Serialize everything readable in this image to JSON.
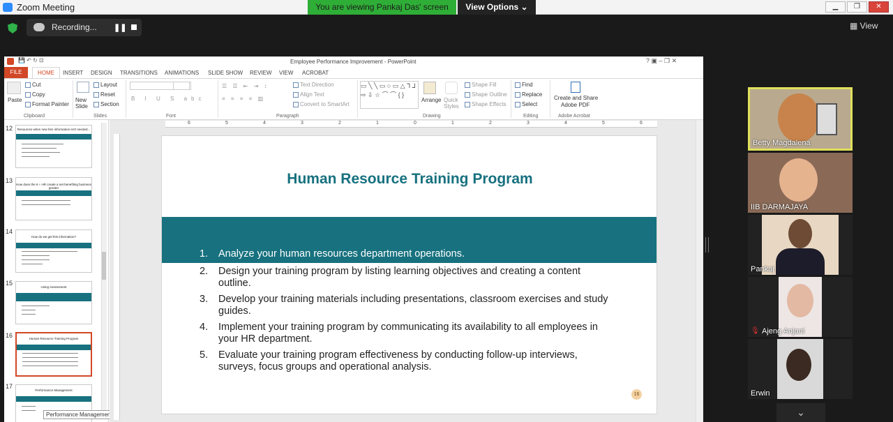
{
  "zoom": {
    "title": "Zoom Meeting",
    "banner": "You are viewing Pankaj Das' screen",
    "view_options": "View Options ⌄",
    "recording_label": "Recording...",
    "view_label": "View",
    "participants": [
      {
        "name": "Betty Magdalena"
      },
      {
        "name": "IIB DARMAJAYA"
      },
      {
        "name": "Pankaj"
      },
      {
        "name": "Ajeng Anjani"
      },
      {
        "name": "Erwin"
      }
    ]
  },
  "ppt": {
    "window_title": "Employee Performance Improvement - PowerPoint",
    "tabs": [
      "FILE",
      "HOME",
      "INSERT",
      "DESIGN",
      "TRANSITIONS",
      "ANIMATIONS",
      "SLIDE SHOW",
      "REVIEW",
      "VIEW",
      "ACROBAT"
    ],
    "ribbon": {
      "paste": "Paste",
      "cut": "Cut",
      "copy": "Copy",
      "format_painter": "Format Painter",
      "clipboard": "Clipboard",
      "new_slide": "New Slide",
      "layout": "Layout",
      "reset": "Reset",
      "section": "Section",
      "slides": "Slides",
      "font": "Font",
      "text_direction": "Text Direction",
      "align_text": "Align Text",
      "convert_smartart": "Convert to SmartArt",
      "paragraph": "Paragraph",
      "arrange": "Arrange",
      "quick_styles": "Quick Styles",
      "shape_fill": "Shape Fill",
      "shape_outline": "Shape Outline",
      "shape_effects": "Shape Effects",
      "drawing": "Drawing",
      "find": "Find",
      "replace": "Replace",
      "select": "Select",
      "editing": "Editing",
      "create_share": "Create and Share",
      "adobe_pdf": "Adobe PDF",
      "adobe_acrobat": "Adobe Acrobat"
    },
    "thumbnails": [
      {
        "num": "12",
        "title": "Resources when new hire information isn't needed..."
      },
      {
        "num": "13",
        "title": "How does the 6 + HR create a net benefiting business greater"
      },
      {
        "num": "14",
        "title": "How do we get this information?"
      },
      {
        "num": "15",
        "title": "Using Assessment"
      },
      {
        "num": "16",
        "title": "Human Resource Training Program"
      },
      {
        "num": "17",
        "title": "Performance Management"
      }
    ],
    "tooltip": "Performance Management",
    "ruler_marks": [
      "6",
      "5",
      "4",
      "3",
      "2",
      "1",
      "0",
      "1",
      "2",
      "3",
      "4",
      "5",
      "6"
    ],
    "slide": {
      "title": "Human Resource Training Program",
      "items": [
        {
          "n": "1.",
          "text": "Analyze your human resources department operations."
        },
        {
          "n": "2.",
          "text": "Design your training program by listing learning objectives and creating a content outline."
        },
        {
          "n": "3.",
          "text": "Develop your training materials including presentations, classroom exercises and study guides."
        },
        {
          "n": "4.",
          "text": "Implement your training program by communicating its availability to all employees in your HR department."
        },
        {
          "n": "5.",
          "text": "Evaluate your training program effectiveness by conducting follow-up interviews, surveys, focus groups and operational analysis."
        }
      ],
      "page_number": "16"
    }
  }
}
